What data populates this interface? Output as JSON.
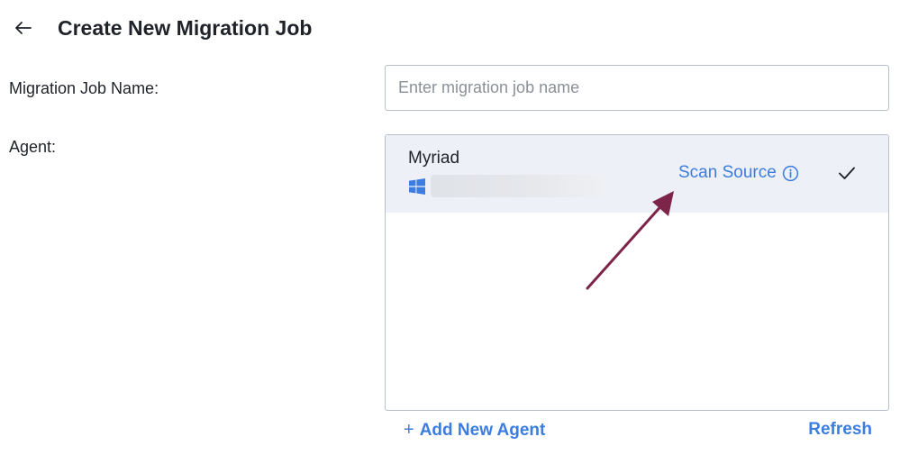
{
  "header": {
    "back_icon": "arrow-left-icon",
    "title": "Create New Migration Job"
  },
  "form": {
    "job_name_label": "Migration Job Name:",
    "job_name_placeholder": "Enter migration job name",
    "job_name_value": "",
    "agent_label": "Agent:"
  },
  "agents": [
    {
      "name": "Myriad",
      "os_icon": "windows-icon",
      "scan_label": "Scan Source",
      "info_icon": "info-circle-icon",
      "selected": true,
      "selected_icon": "checkmark-icon"
    }
  ],
  "actions": {
    "add_icon": "plus-icon",
    "add_agent_label": "Add New Agent",
    "refresh_label": "Refresh"
  },
  "colors": {
    "accent": "#3b7de0",
    "selected_row": "#edf0f7",
    "annotation_arrow": "#7d2449"
  }
}
